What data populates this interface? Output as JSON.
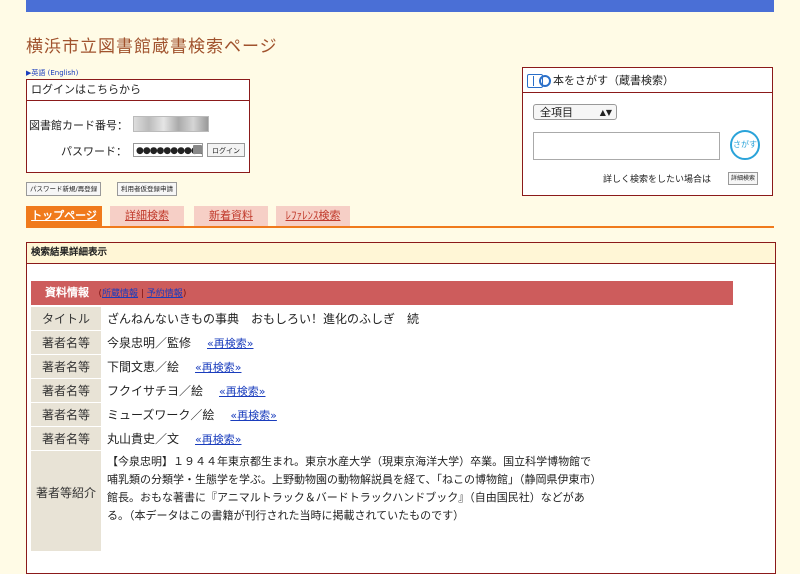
{
  "site_title": "横浜市立図書館蔵書検索ページ",
  "lang_link": "▶英語 (English)",
  "login": {
    "heading": "ログインはこちらから",
    "card_label": "図書館カード番号：",
    "password_label": "パスワード：",
    "password_value": "●●●●●●●●●●●●●",
    "login_button": "ログイン"
  },
  "small_buttons": [
    "パスワード新規/再登録",
    "利用者仮登録申請"
  ],
  "search": {
    "heading": "本をさがす（蔵書検索）",
    "select_value": "全項目",
    "search_button": "さがす",
    "detail_text": "詳しく検索をしたい場合は",
    "detail_button": "詳細検索"
  },
  "tabs": [
    "トップページ",
    "詳細検索",
    "新着資料",
    "ﾚﾌｧﾚﾝｽ検索"
  ],
  "result_heading": "検索結果詳細表示",
  "info_header": {
    "title": "資料情報",
    "link_holdings": "所蔵情報",
    "link_reserve": "予約情報"
  },
  "rows": [
    {
      "label": "タイトル",
      "value": "ざんねんないきもの事典　おもしろい！進化のふしぎ　続",
      "link": ""
    },
    {
      "label": "著者名等",
      "value": "今泉忠明／監修",
      "link": "«再検索»"
    },
    {
      "label": "著者名等",
      "value": "下間文恵／絵",
      "link": "«再検索»"
    },
    {
      "label": "著者名等",
      "value": "フクイサチヨ／絵",
      "link": "«再検索»"
    },
    {
      "label": "著者名等",
      "value": "ミューズワーク／絵",
      "link": "«再検索»"
    },
    {
      "label": "著者名等",
      "value": "丸山貴史／文",
      "link": "«再検索»"
    }
  ],
  "intro": {
    "label": "著者等紹介",
    "value": "【今泉忠明】１９４４年東京都生まれ。東京水産大学（現東京海洋大学）卒業。国立科学博物館で哺乳類の分類学・生態学を学ぶ。上野動物園の動物解説員を経て、「ねこの博物館」（静岡県伊東市）館長。おもな著書に『アニマルトラック＆バードトラックハンドブック』（自由国民社）などがある。（本データはこの書籍が刊行された当時に掲載されていたものです）"
  }
}
